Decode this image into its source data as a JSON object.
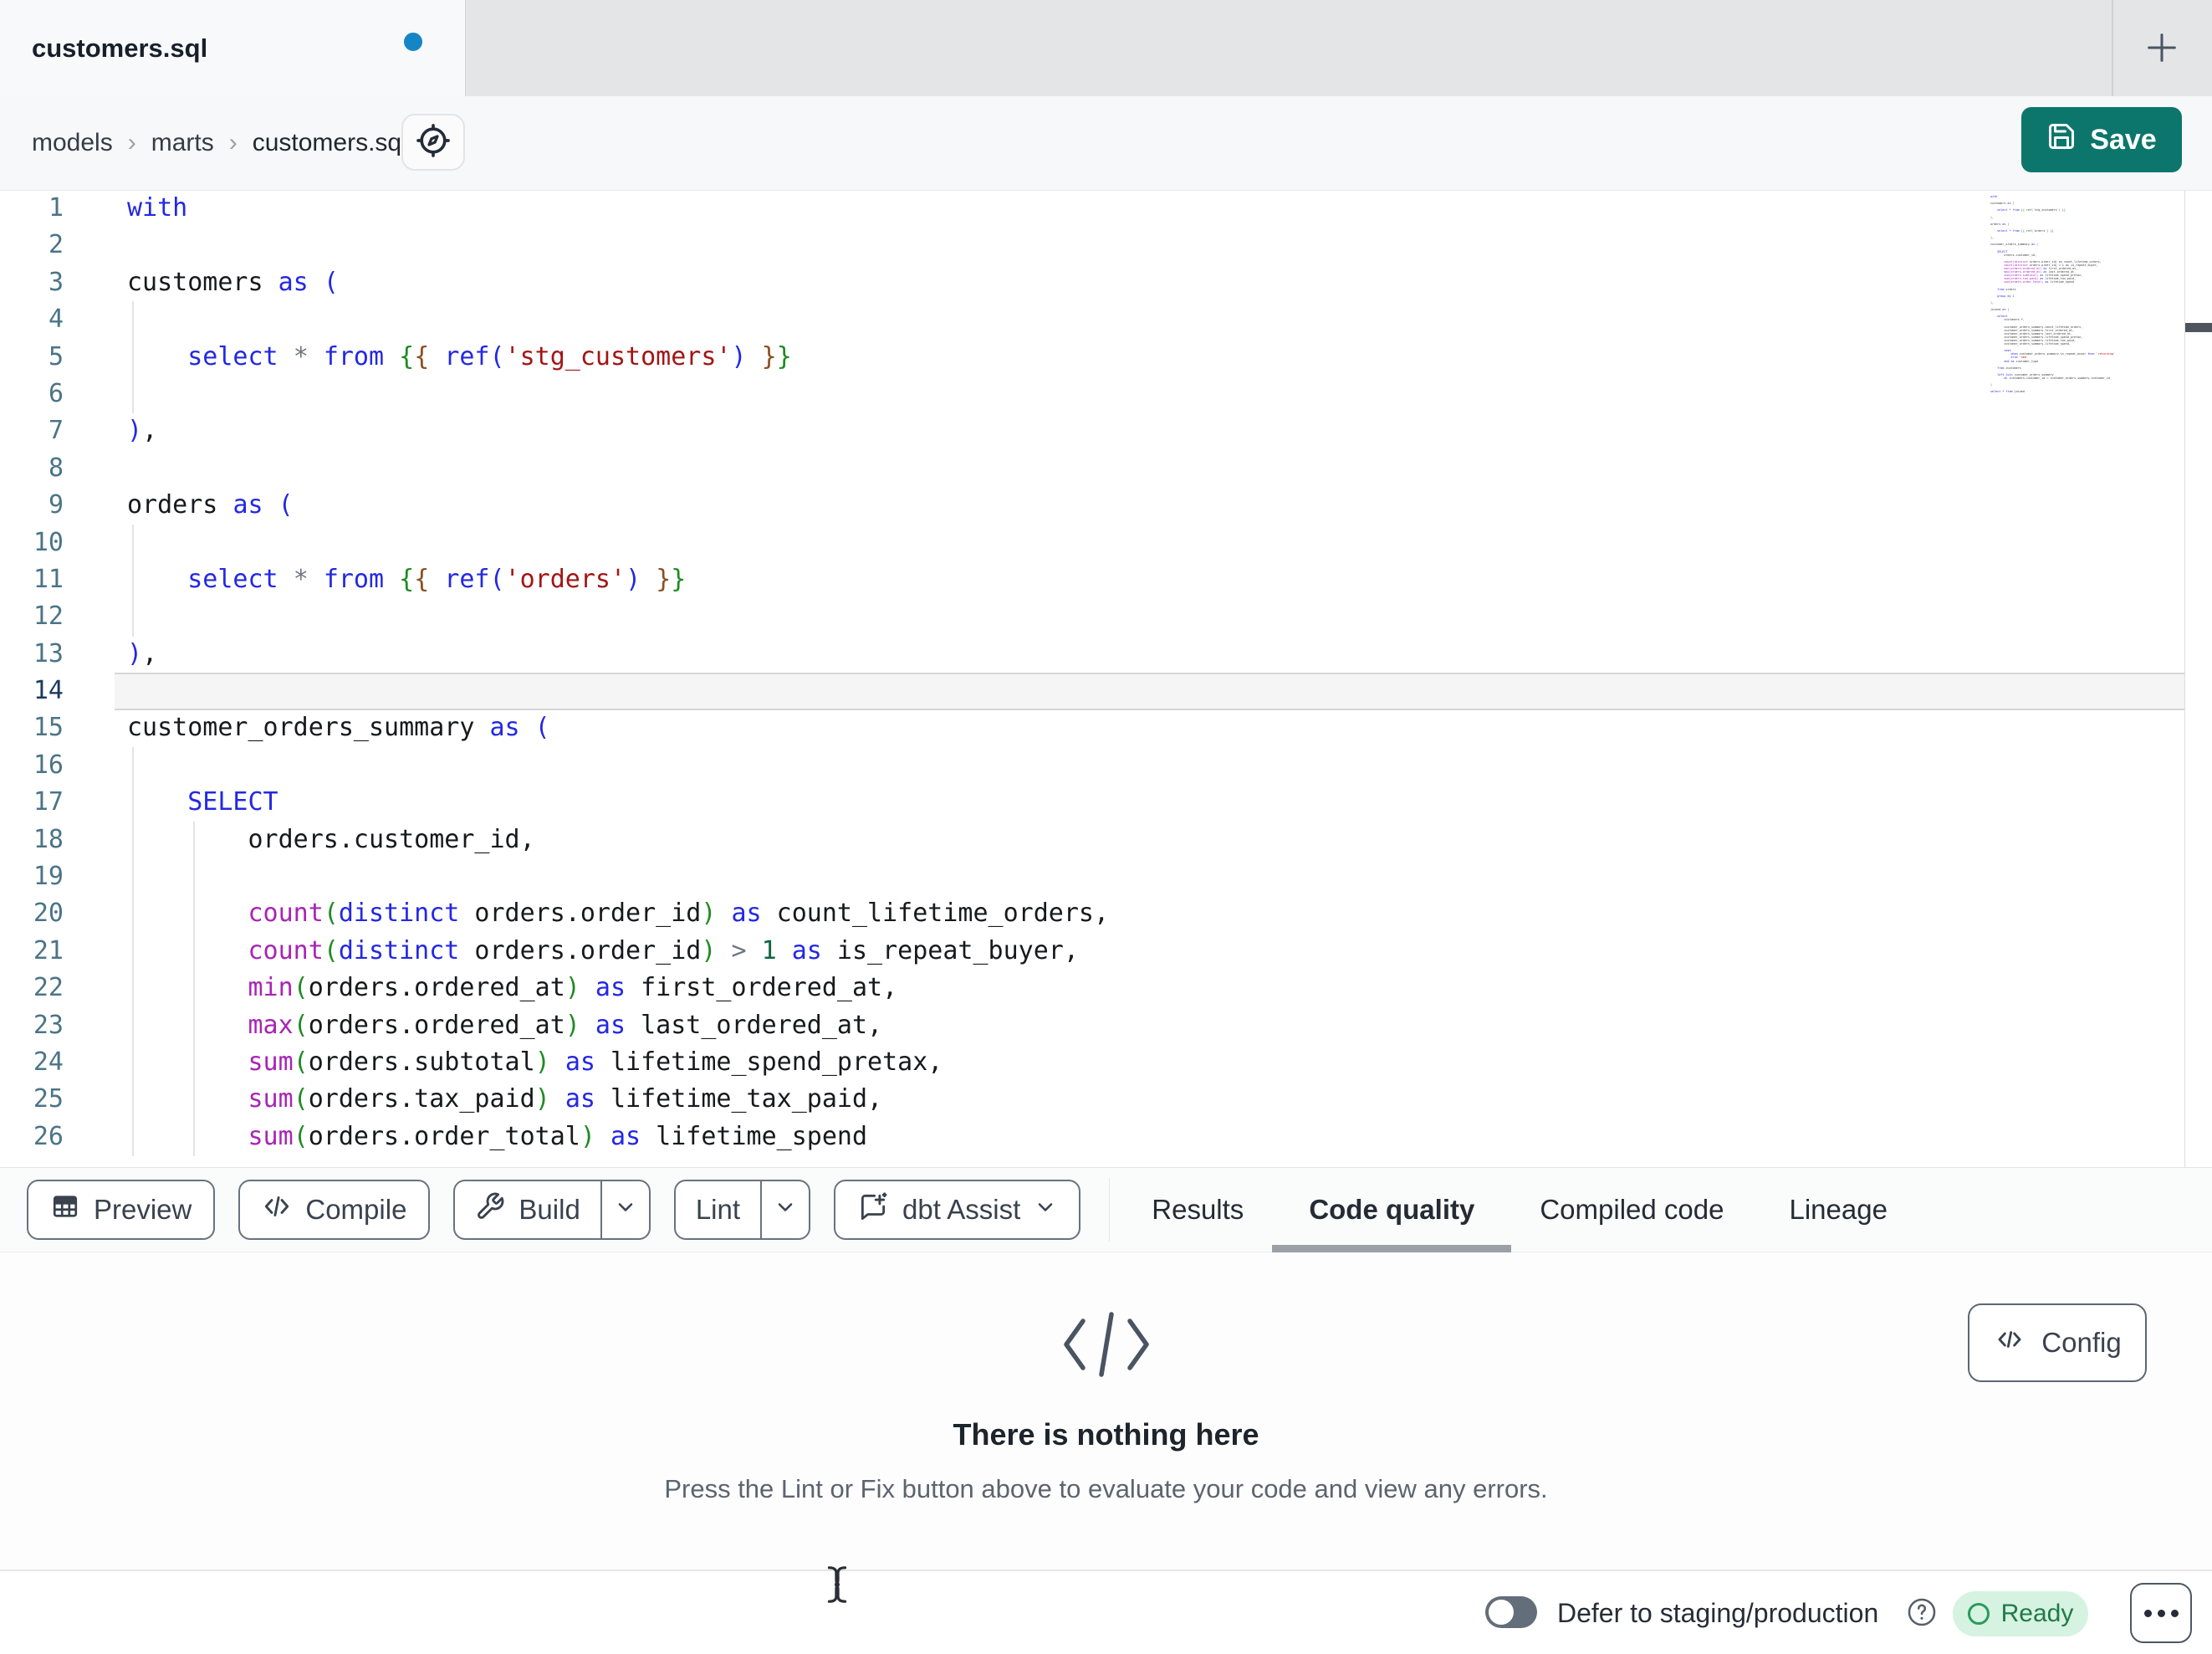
{
  "colors": {
    "accent_teal": "#0d766c",
    "unsaved_dot": "#1585c5",
    "ready_bg": "#d6f2e0",
    "ready_text": "#1f7a4a",
    "ready_ring": "#2a9a5b",
    "syntax_keyword": "#2328e3",
    "syntax_function": "#a824b5",
    "syntax_string": "#a31515",
    "syntax_number": "#116644",
    "syntax_operator": "#6f7680",
    "bracket_blue": "#2328e3",
    "bracket_green": "#1e8a22",
    "bracket_brown": "#8c4f21",
    "line_number": "#4b7487",
    "line_number_active": "#1c3a5e"
  },
  "tab_bar": {
    "active_tab_title": "customers.sql",
    "unsaved": true
  },
  "breadcrumb": {
    "items": [
      "models",
      "marts",
      "customers.sql"
    ],
    "separator": "›"
  },
  "header": {
    "save_label": "Save"
  },
  "editor": {
    "active_line": 14,
    "lines": [
      {
        "n": 1,
        "t": [
          [
            "kw",
            "with"
          ]
        ]
      },
      {
        "n": 2,
        "t": []
      },
      {
        "n": 3,
        "t": [
          [
            "pl",
            "customers "
          ],
          [
            "kw",
            "as"
          ],
          [
            "pl",
            " "
          ],
          [
            "b1",
            "("
          ]
        ]
      },
      {
        "n": 4,
        "t": []
      },
      {
        "n": 5,
        "t": [
          [
            "pl",
            "    "
          ],
          [
            "kw",
            "select"
          ],
          [
            "pl",
            " "
          ],
          [
            "op",
            "*"
          ],
          [
            "pl",
            " "
          ],
          [
            "kw",
            "from"
          ],
          [
            "pl",
            " "
          ],
          [
            "b2",
            "{"
          ],
          [
            "b3",
            "{"
          ],
          [
            "pl",
            " "
          ],
          [
            "kw",
            "ref"
          ],
          [
            "b1",
            "("
          ],
          [
            "str",
            "'stg_customers'"
          ],
          [
            "b1",
            ")"
          ],
          [
            "pl",
            " "
          ],
          [
            "b3",
            "}"
          ],
          [
            "b2",
            "}"
          ]
        ]
      },
      {
        "n": 6,
        "t": []
      },
      {
        "n": 7,
        "t": [
          [
            "b1",
            ")"
          ],
          [
            "pl",
            ","
          ]
        ]
      },
      {
        "n": 8,
        "t": []
      },
      {
        "n": 9,
        "t": [
          [
            "pl",
            "orders "
          ],
          [
            "kw",
            "as"
          ],
          [
            "pl",
            " "
          ],
          [
            "b1",
            "("
          ]
        ]
      },
      {
        "n": 10,
        "t": []
      },
      {
        "n": 11,
        "t": [
          [
            "pl",
            "    "
          ],
          [
            "kw",
            "select"
          ],
          [
            "pl",
            " "
          ],
          [
            "op",
            "*"
          ],
          [
            "pl",
            " "
          ],
          [
            "kw",
            "from"
          ],
          [
            "pl",
            " "
          ],
          [
            "b2",
            "{"
          ],
          [
            "b3",
            "{"
          ],
          [
            "pl",
            " "
          ],
          [
            "kw",
            "ref"
          ],
          [
            "b1",
            "("
          ],
          [
            "str",
            "'orders'"
          ],
          [
            "b1",
            ")"
          ],
          [
            "pl",
            " "
          ],
          [
            "b3",
            "}"
          ],
          [
            "b2",
            "}"
          ]
        ]
      },
      {
        "n": 12,
        "t": []
      },
      {
        "n": 13,
        "t": [
          [
            "b1",
            ")"
          ],
          [
            "pl",
            ","
          ]
        ]
      },
      {
        "n": 14,
        "t": []
      },
      {
        "n": 15,
        "t": [
          [
            "pl",
            "customer_orders_summary "
          ],
          [
            "kw",
            "as"
          ],
          [
            "pl",
            " "
          ],
          [
            "b1",
            "("
          ]
        ]
      },
      {
        "n": 16,
        "t": []
      },
      {
        "n": 17,
        "t": [
          [
            "pl",
            "    "
          ],
          [
            "kw",
            "SELECT"
          ]
        ]
      },
      {
        "n": 18,
        "t": [
          [
            "pl",
            "        orders.customer_id,"
          ]
        ]
      },
      {
        "n": 19,
        "t": []
      },
      {
        "n": 20,
        "t": [
          [
            "pl",
            "        "
          ],
          [
            "fn",
            "count"
          ],
          [
            "b2",
            "("
          ],
          [
            "kw",
            "distinct"
          ],
          [
            "pl",
            " orders.order_id"
          ],
          [
            "b2",
            ")"
          ],
          [
            "pl",
            " "
          ],
          [
            "kw",
            "as"
          ],
          [
            "pl",
            " count_lifetime_orders,"
          ]
        ]
      },
      {
        "n": 21,
        "t": [
          [
            "pl",
            "        "
          ],
          [
            "fn",
            "count"
          ],
          [
            "b2",
            "("
          ],
          [
            "kw",
            "distinct"
          ],
          [
            "pl",
            " orders.order_id"
          ],
          [
            "b2",
            ")"
          ],
          [
            "pl",
            " "
          ],
          [
            "op",
            ">"
          ],
          [
            "pl",
            " "
          ],
          [
            "num",
            "1"
          ],
          [
            "pl",
            " "
          ],
          [
            "kw",
            "as"
          ],
          [
            "pl",
            " is_repeat_buyer,"
          ]
        ]
      },
      {
        "n": 22,
        "t": [
          [
            "pl",
            "        "
          ],
          [
            "fn",
            "min"
          ],
          [
            "b2",
            "("
          ],
          [
            "pl",
            "orders.ordered_at"
          ],
          [
            "b2",
            ")"
          ],
          [
            "pl",
            " "
          ],
          [
            "kw",
            "as"
          ],
          [
            "pl",
            " first_ordered_at,"
          ]
        ]
      },
      {
        "n": 23,
        "t": [
          [
            "pl",
            "        "
          ],
          [
            "fn",
            "max"
          ],
          [
            "b2",
            "("
          ],
          [
            "pl",
            "orders.ordered_at"
          ],
          [
            "b2",
            ")"
          ],
          [
            "pl",
            " "
          ],
          [
            "kw",
            "as"
          ],
          [
            "pl",
            " last_ordered_at,"
          ]
        ]
      },
      {
        "n": 24,
        "t": [
          [
            "pl",
            "        "
          ],
          [
            "fn",
            "sum"
          ],
          [
            "b2",
            "("
          ],
          [
            "pl",
            "orders.subtotal"
          ],
          [
            "b2",
            ")"
          ],
          [
            "pl",
            " "
          ],
          [
            "kw",
            "as"
          ],
          [
            "pl",
            " lifetime_spend_pretax,"
          ]
        ]
      },
      {
        "n": 25,
        "t": [
          [
            "pl",
            "        "
          ],
          [
            "fn",
            "sum"
          ],
          [
            "b2",
            "("
          ],
          [
            "pl",
            "orders.tax_paid"
          ],
          [
            "b2",
            ")"
          ],
          [
            "pl",
            " "
          ],
          [
            "kw",
            "as"
          ],
          [
            "pl",
            " lifetime_tax_paid,"
          ]
        ]
      },
      {
        "n": 26,
        "t": [
          [
            "pl",
            "        "
          ],
          [
            "fn",
            "sum"
          ],
          [
            "b2",
            "("
          ],
          [
            "pl",
            "orders.order_total"
          ],
          [
            "b2",
            ")"
          ],
          [
            "pl",
            " "
          ],
          [
            "kw",
            "as"
          ],
          [
            "pl",
            " lifetime_spend"
          ]
        ]
      }
    ],
    "minimap_lines": [
      "with",
      "",
      "customers as (",
      "",
      "    select * from {{ ref('stg_customers') }}",
      "",
      "),",
      "",
      "orders as (",
      "",
      "    select * from {{ ref('orders') }}",
      "",
      "),",
      "",
      "customer_orders_summary as (",
      "",
      "    SELECT",
      "        orders.customer_id,",
      "",
      "        count(distinct orders.order_id) as count_lifetime_orders,",
      "        count(distinct orders.order_id) > 1 as is_repeat_buyer,",
      "        min(orders.ordered_at) as first_ordered_at,",
      "        max(orders.ordered_at) as last_ordered_at,",
      "        sum(orders.subtotal) as lifetime_spend_pretax,",
      "        sum(orders.tax_paid) as lifetime_tax_paid,",
      "        sum(orders.order_total) as lifetime_spend",
      "",
      "    from orders",
      "",
      "    group by 1",
      "",
      "),",
      "",
      "joined as (",
      "",
      "    select",
      "        customers.*,",
      "",
      "        customer_orders_summary.count_lifetime_orders,",
      "        customer_orders_summary.first_ordered_at,",
      "        customer_orders_summary.last_ordered_at,",
      "        customer_orders_summary.lifetime_spend_pretax,",
      "        customer_orders_summary.lifetime_tax_paid,",
      "        customer_orders_summary.lifetime_spend,",
      "",
      "        case",
      "            when customer_orders_summary.is_repeat_buyer then 'returning'",
      "            else 'new'",
      "        end as customer_type",
      "",
      "    from customers",
      "",
      "    left join customer_orders_summary",
      "        on customers.customer_id = customer_orders_summary.customer_id",
      "",
      ")",
      "",
      "select * from joined"
    ]
  },
  "toolbar": {
    "preview_label": "Preview",
    "compile_label": "Compile",
    "build_label": "Build",
    "lint_label": "Lint",
    "dbt_assist_label": "dbt Assist"
  },
  "panel_tabs": [
    {
      "label": "Results",
      "active": false
    },
    {
      "label": "Code quality",
      "active": true
    },
    {
      "label": "Compiled code",
      "active": false
    },
    {
      "label": "Lineage",
      "active": false
    }
  ],
  "empty_state": {
    "title": "There is nothing here",
    "description": "Press the Lint or Fix button above to evaluate your code and view any errors."
  },
  "config_button": {
    "label": "Config"
  },
  "status_bar": {
    "defer_label": "Defer to staging/production",
    "ready_label": "Ready"
  }
}
